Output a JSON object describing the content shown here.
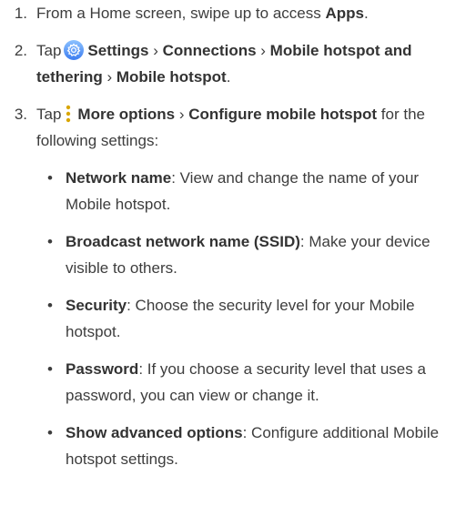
{
  "steps": [
    {
      "num": "1.",
      "text_a": "From a Home screen, swipe up to access ",
      "bold_a": "Apps",
      "text_b": "."
    },
    {
      "num": "2.",
      "tap": "Tap",
      "settings": "Settings",
      "sep1": " › ",
      "connections": "Connections",
      "sep2": " › ",
      "hotspot_tethering": "Mobile hotspot and tethering",
      "sep3": " › ",
      "mobile_hotspot": "Mobile hotspot",
      "end": "."
    },
    {
      "num": "3.",
      "tap": "Tap",
      "more_options": "More options",
      "sep": " › ",
      "configure": "Configure mobile hotspot",
      "tail": " for the following settings:"
    }
  ],
  "bullets": [
    {
      "title": "Network name",
      "text": ": View and change the name of your Mobile hotspot."
    },
    {
      "title": "Broadcast network name (SSID)",
      "text": ": Make your device visible to others."
    },
    {
      "title": "Security",
      "text": ": Choose the security level for your Mobile hotspot."
    },
    {
      "title": "Password",
      "text": ": If you choose a security level that uses a password, you can view or change it."
    },
    {
      "title": "Show advanced options",
      "text": ": Configure additional Mobile hotspot settings."
    }
  ],
  "bullet_symbol": "•",
  "icons": {
    "settings": "gear-icon",
    "more_options": "more-options-icon"
  },
  "colors": {
    "text": "#3d3d3d",
    "settings_icon_start": "#6fb1ff",
    "settings_icon_end": "#3d7df0",
    "more_dots": "#d9a600"
  }
}
